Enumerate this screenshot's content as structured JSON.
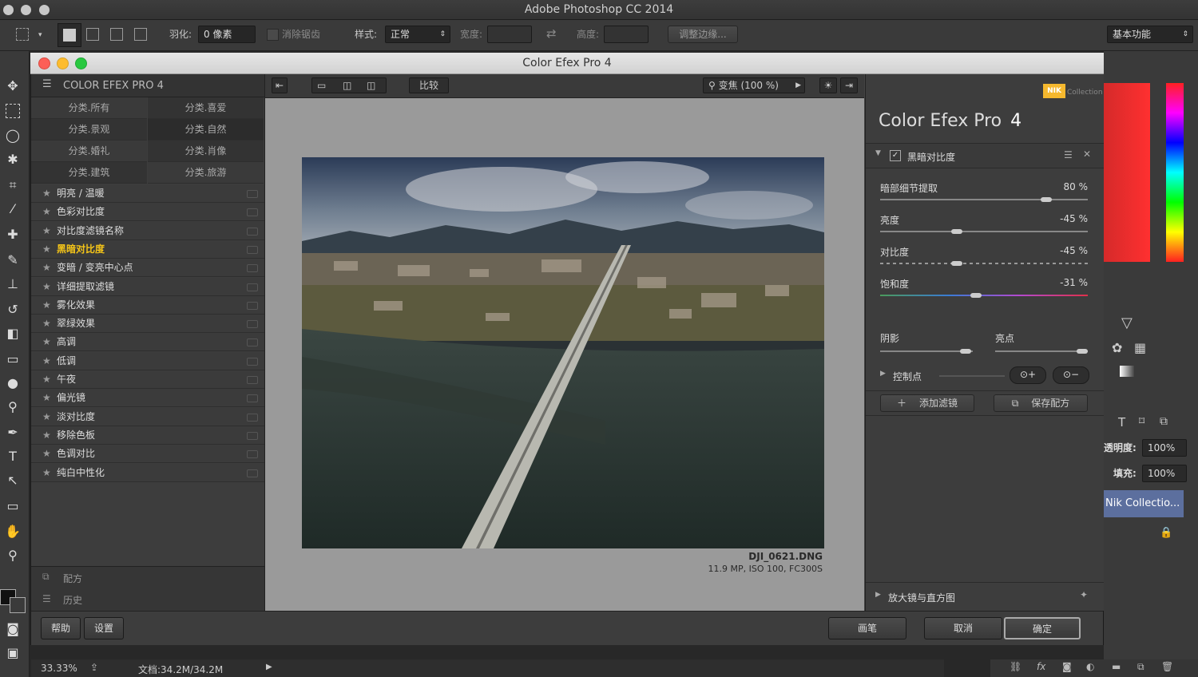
{
  "app": {
    "title": "Adobe Photoshop CC 2014"
  },
  "options": {
    "feather_label": "羽化:",
    "feather_value": "0 像素",
    "antialias_label": "消除锯齿",
    "style_label": "样式:",
    "style_value": "正常",
    "width_label": "宽度:",
    "height_label": "高度:",
    "refine_edge": "调整边缘...",
    "workspace": "基本功能"
  },
  "dialog": {
    "title": "Color Efex Pro 4"
  },
  "left": {
    "header": "COLOR EFEX PRO 4",
    "categories": [
      "分类.所有",
      "分类.喜爱",
      "分类.景观",
      "分类.自然",
      "分类.婚礼",
      "分类.肖像",
      "分类.建筑",
      "分类.旅游"
    ],
    "filters": [
      "明亮 / 温暖",
      "色彩对比度",
      "对比度滤镜名称",
      "黑暗对比度",
      "变暗 / 变亮中心点",
      "详细提取滤镜",
      "雾化效果",
      "翠绿效果",
      "高调",
      "低调",
      "午夜",
      "偏光镜",
      "淡对比度",
      "移除色板",
      "色调对比",
      "纯白中性化"
    ],
    "selected_index": 3,
    "recipes": "配方",
    "history": "历史"
  },
  "center": {
    "compare": "比较",
    "zoom": "变焦 (100 %)",
    "filename": "DJI_0621.DNG",
    "meta": "11.9 MP, ISO 100, FC300S"
  },
  "right": {
    "nik": "NIK",
    "collection": "Collection",
    "title_main": "Color Efex Pro",
    "title_num": "4",
    "filter_name": "黑暗对比度",
    "sliders": [
      {
        "label": "暗部细节提取",
        "value": "80 %",
        "level": 0.8
      },
      {
        "label": "亮度",
        "value": "-45 %",
        "level": 0.37
      },
      {
        "label": "对比度",
        "value": "-45 %",
        "level": 0.37
      },
      {
        "label": "饱和度",
        "value": "-31 %",
        "level": 0.46
      }
    ],
    "shadows": "阴影",
    "highlights": "亮点",
    "control_points": "控制点",
    "add_filter": "添加滤镜",
    "save_recipe": "保存配方",
    "loupe": "放大镜与直方图"
  },
  "bottom": {
    "help": "帮助",
    "settings": "设置",
    "brush": "画笔",
    "cancel": "取消",
    "ok": "确定"
  },
  "ps_right": {
    "opacity_label": "透明度:",
    "opacity_value": "100%",
    "fill_label": "填充:",
    "fill_value": "100%",
    "layer_name": "Nik Collectio..."
  },
  "status": {
    "zoom": "33.33%",
    "doc": "文档:34.2M/34.2M"
  }
}
